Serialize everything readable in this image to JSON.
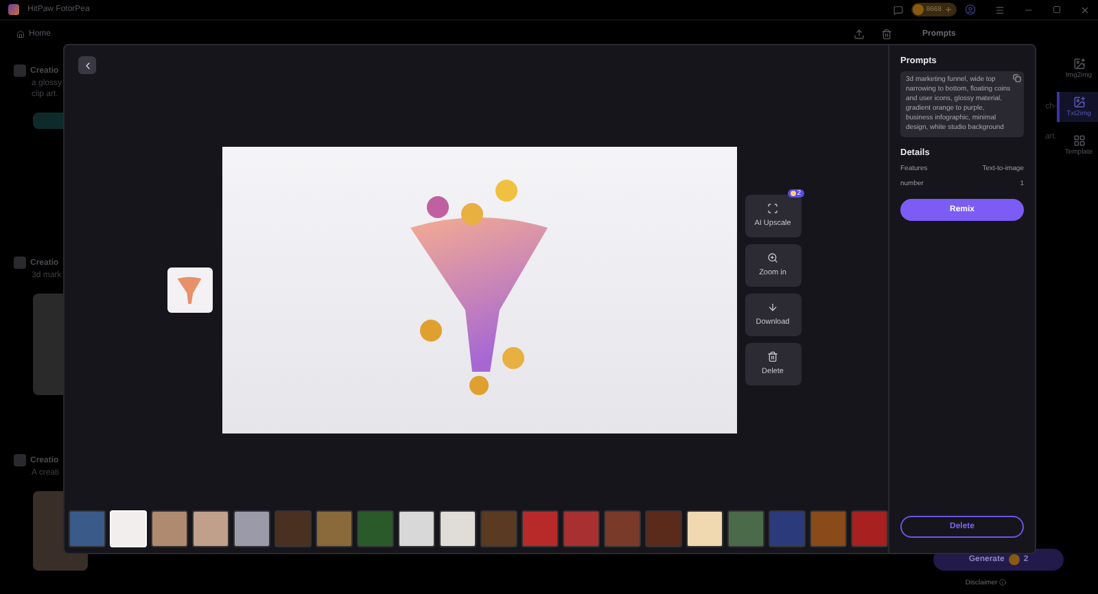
{
  "app": {
    "title": "HitPaw FotorPea",
    "credits": "8668",
    "nav": "Home",
    "prompts_heading": "Prompts"
  },
  "feed": [
    {
      "title": "Creatio",
      "lines": [
        "a glossy",
        "clip art."
      ]
    },
    {
      "title": "Creatio",
      "lines": [
        "3d mark"
      ]
    },
    {
      "title": "Creatio",
      "lines": [
        "A creati"
      ]
    }
  ],
  "behind_fragments": [
    "ch-",
    "art."
  ],
  "sidebar": [
    {
      "label": "Img2img",
      "selected": false
    },
    {
      "label": "Txt2img",
      "selected": true
    },
    {
      "label": "Template",
      "selected": false
    }
  ],
  "generate": {
    "label": "Generate",
    "cost": "2"
  },
  "disclaimer": "Disclaimer",
  "viewer": {
    "actions": [
      {
        "kind": "upscale",
        "label": "AI Upscale",
        "badge": "2"
      },
      {
        "kind": "zoom",
        "label": "Zoom in"
      },
      {
        "kind": "download",
        "label": "Download"
      },
      {
        "kind": "delete",
        "label": "Delete"
      }
    ],
    "thumbnails": [
      {
        "selected": false
      },
      {
        "selected": true
      },
      {
        "selected": false
      },
      {
        "selected": false
      },
      {
        "selected": false
      },
      {
        "selected": false
      },
      {
        "selected": false
      },
      {
        "selected": false
      },
      {
        "selected": false
      },
      {
        "selected": false
      },
      {
        "selected": false
      },
      {
        "selected": false
      },
      {
        "selected": false
      },
      {
        "selected": false
      },
      {
        "selected": false
      },
      {
        "selected": false
      },
      {
        "selected": false
      },
      {
        "selected": false
      },
      {
        "selected": false
      },
      {
        "selected": false
      }
    ],
    "panel": {
      "prompts_title": "Prompts",
      "prompt": "3d marketing funnel, wide top narrowing to bottom, floating coins and user icons, glossy material, gradient orange to purple, business infographic, minimal design, white studio background",
      "details_title": "Details",
      "details": [
        {
          "label": "Features",
          "value": "Text-to-image"
        },
        {
          "label": "number",
          "value": "1"
        }
      ],
      "remix": "Remix",
      "delete": "Delete"
    }
  }
}
